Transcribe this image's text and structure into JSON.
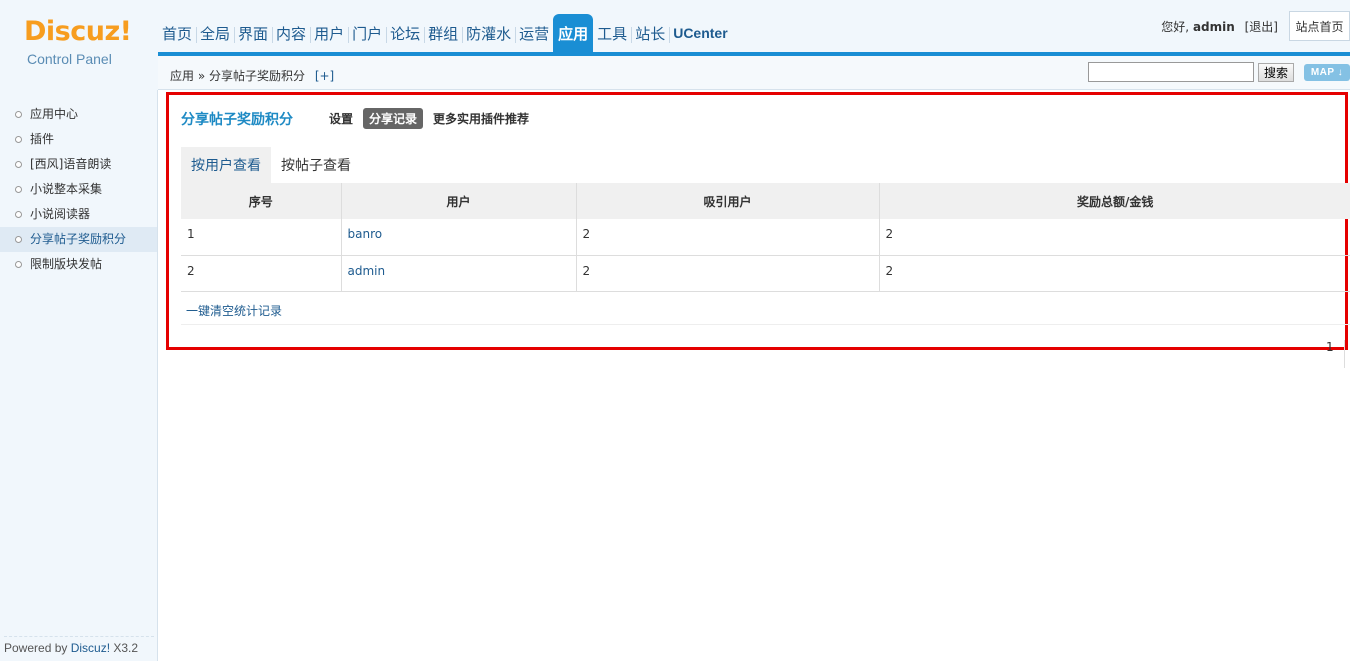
{
  "logo": {
    "brand": "Discuz!",
    "sub": "Control Panel"
  },
  "nav": {
    "items": [
      {
        "label": "首页"
      },
      {
        "label": "全局"
      },
      {
        "label": "界面"
      },
      {
        "label": "内容"
      },
      {
        "label": "用户"
      },
      {
        "label": "门户"
      },
      {
        "label": "论坛"
      },
      {
        "label": "群组"
      },
      {
        "label": "防灌水"
      },
      {
        "label": "运营"
      },
      {
        "label": "应用"
      },
      {
        "label": "工具"
      },
      {
        "label": "站长"
      },
      {
        "label": "UCenter"
      }
    ],
    "active_index": 10
  },
  "user": {
    "greeting": "您好,",
    "name": "admin",
    "logout": "[退出]",
    "site_home": "站点首页"
  },
  "subbar": {
    "breadcrumb": "应用 » 分享帖子奖励积分",
    "plus": "[+]",
    "search_value": "",
    "search_label": "搜索",
    "map_label": "MAP ↓"
  },
  "sidebar": {
    "items": [
      {
        "label": "应用中心"
      },
      {
        "label": "插件"
      },
      {
        "label": "[西风]语音朗读"
      },
      {
        "label": "小说整本采集"
      },
      {
        "label": "小说阅读器"
      },
      {
        "label": "分享帖子奖励积分"
      },
      {
        "label": "限制版块发帖"
      }
    ],
    "active_index": 5,
    "powered_prefix": "Powered by ",
    "powered_brand": "Discuz!",
    "powered_version": " X3.2"
  },
  "main": {
    "title": "分享帖子奖励积分",
    "plugin_tabs": [
      {
        "label": "设置"
      },
      {
        "label": "分享记录"
      },
      {
        "label": "更多实用插件推荐"
      }
    ],
    "plugin_tab_active": 1,
    "view_tabs": [
      {
        "label": "按用户查看"
      },
      {
        "label": "按帖子查看"
      }
    ],
    "view_tab_active": 0,
    "table": {
      "headers": [
        "序号",
        "用户",
        "吸引用户",
        "奖励总额/金钱"
      ],
      "rows": [
        [
          "1",
          "banro",
          "2",
          "2"
        ],
        [
          "2",
          "admin",
          "2",
          "2"
        ]
      ]
    },
    "clear_link": "一键清空统计记录",
    "page": "1"
  },
  "colors": {
    "accent": "#1a8ed4",
    "highlight_border": "#e50000",
    "logo": "#f79d1f"
  }
}
